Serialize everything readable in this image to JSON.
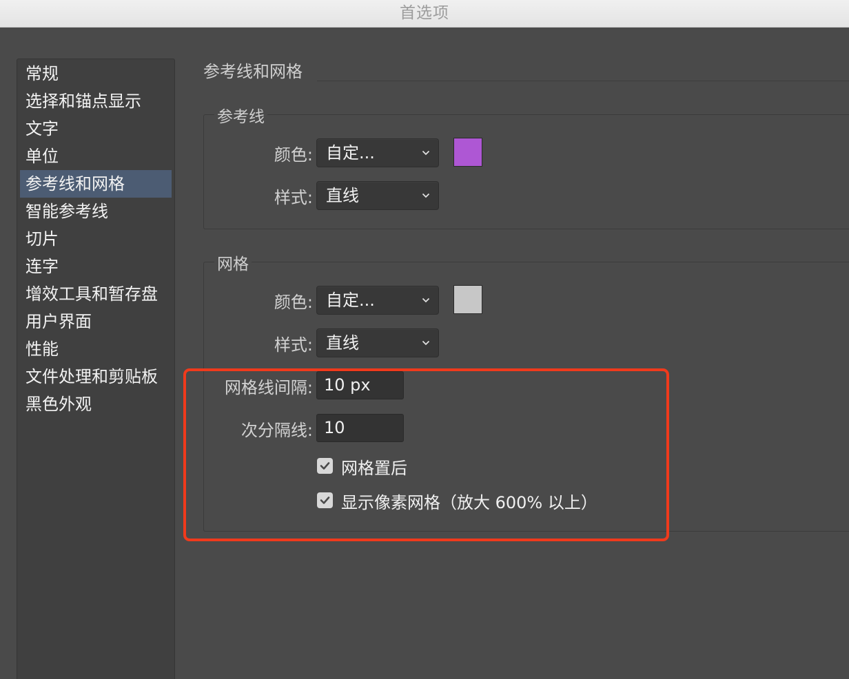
{
  "window": {
    "title": "首选项"
  },
  "sidebar": {
    "items": [
      {
        "label": "常规",
        "selected": false
      },
      {
        "label": "选择和锚点显示",
        "selected": false
      },
      {
        "label": "文字",
        "selected": false
      },
      {
        "label": "单位",
        "selected": false
      },
      {
        "label": "参考线和网格",
        "selected": true
      },
      {
        "label": "智能参考线",
        "selected": false
      },
      {
        "label": "切片",
        "selected": false
      },
      {
        "label": "连字",
        "selected": false
      },
      {
        "label": "增效工具和暂存盘",
        "selected": false
      },
      {
        "label": "用户界面",
        "selected": false
      },
      {
        "label": "性能",
        "selected": false
      },
      {
        "label": "文件处理和剪贴板",
        "selected": false
      },
      {
        "label": "黑色外观",
        "selected": false
      }
    ]
  },
  "panel": {
    "title": "参考线和网格"
  },
  "guides": {
    "group_label": "参考线",
    "color_label": "颜色:",
    "color_value": "自定...",
    "color_swatch": "#ae57d4",
    "style_label": "样式:",
    "style_value": "直线"
  },
  "grid": {
    "group_label": "网格",
    "color_label": "颜色:",
    "color_value": "自定...",
    "color_swatch": "#c7c7c7",
    "style_label": "样式:",
    "style_value": "直线",
    "gridline_every_label": "网格线间隔:",
    "gridline_every_value": "10 px",
    "subdivisions_label": "次分隔线:",
    "subdivisions_value": "10",
    "grids_in_back": {
      "label": "网格置后",
      "checked": true
    },
    "show_pixel_grid": {
      "label": "显示像素网格（放大 600% 以上）",
      "checked": true
    }
  },
  "annotation": {
    "highlight_color": "#f03a1c"
  },
  "icons": {
    "dropdown": "chevron-down-icon",
    "check": "checkmark-icon"
  }
}
